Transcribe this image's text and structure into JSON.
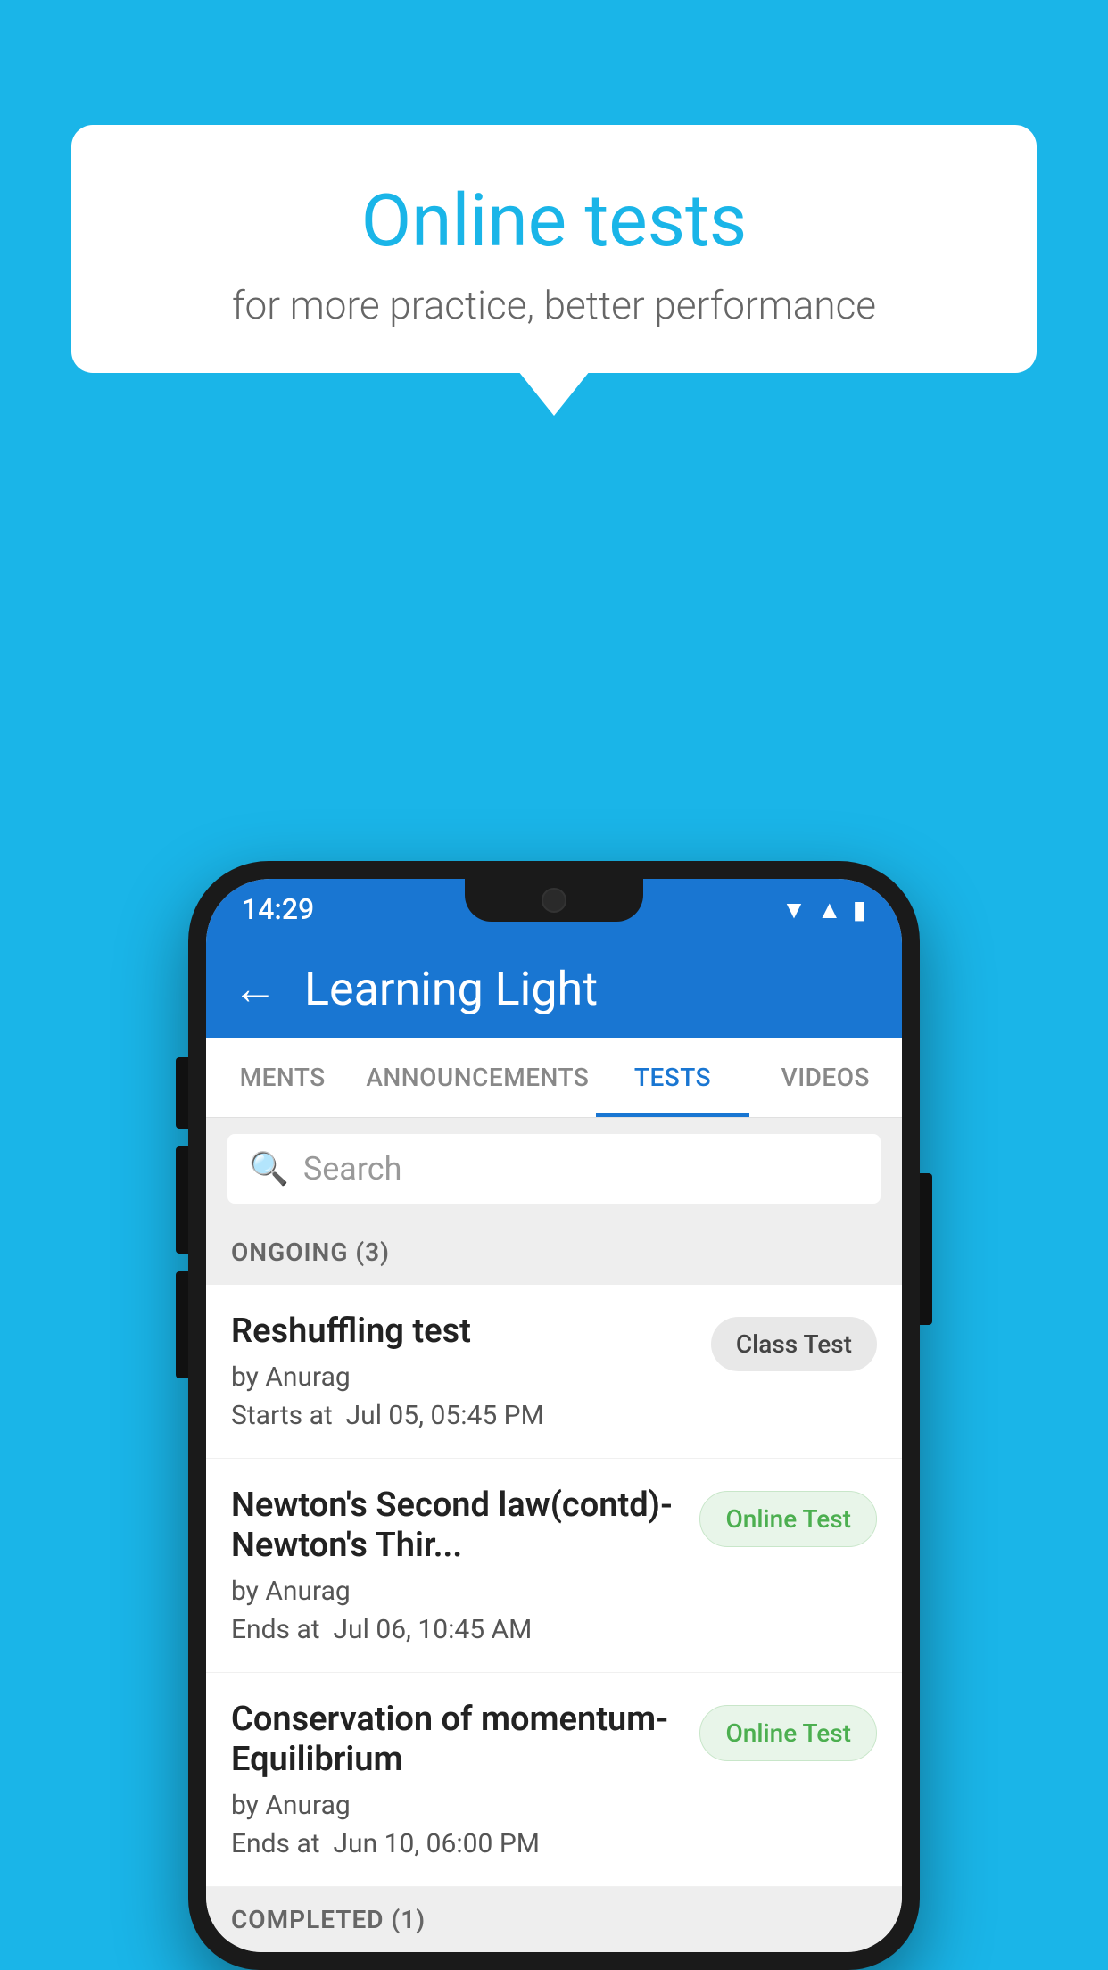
{
  "background": {
    "color": "#1ab5e8"
  },
  "speech_bubble": {
    "title": "Online tests",
    "subtitle": "for more practice, better performance"
  },
  "phone": {
    "status_bar": {
      "time": "14:29",
      "icons": [
        "wifi",
        "signal",
        "battery"
      ]
    },
    "app_bar": {
      "back_label": "←",
      "title": "Learning Light"
    },
    "tabs": [
      {
        "label": "MENTS",
        "active": false
      },
      {
        "label": "ANNOUNCEMENTS",
        "active": false
      },
      {
        "label": "TESTS",
        "active": true
      },
      {
        "label": "VIDEOS",
        "active": false
      }
    ],
    "search": {
      "placeholder": "Search",
      "icon": "search"
    },
    "sections": [
      {
        "header": "ONGOING (3)",
        "items": [
          {
            "name": "Reshuffling test",
            "by": "by Anurag",
            "time_label": "Starts at",
            "time": "Jul 05, 05:45 PM",
            "badge": "Class Test",
            "badge_type": "class"
          },
          {
            "name": "Newton's Second law(contd)-Newton's Thir...",
            "by": "by Anurag",
            "time_label": "Ends at",
            "time": "Jul 06, 10:45 AM",
            "badge": "Online Test",
            "badge_type": "online"
          },
          {
            "name": "Conservation of momentum-Equilibrium",
            "by": "by Anurag",
            "time_label": "Ends at",
            "time": "Jun 10, 06:00 PM",
            "badge": "Online Test",
            "badge_type": "online"
          }
        ]
      },
      {
        "header": "COMPLETED (1)",
        "items": []
      }
    ]
  }
}
